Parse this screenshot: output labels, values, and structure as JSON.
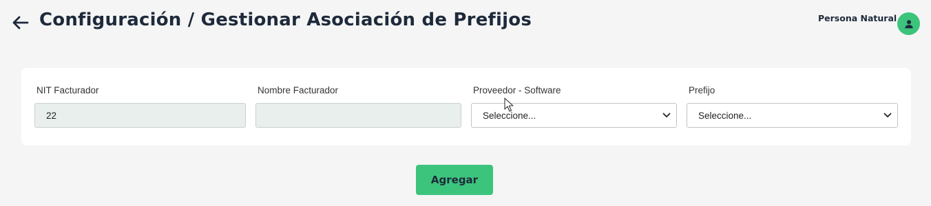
{
  "header": {
    "title": "Configuración / Gestionar Asociación de Prefijos",
    "back_icon": "arrow-left-icon",
    "user_name": "Persona Natural",
    "avatar_icon": "user-icon",
    "accent_color": "#3cc47c"
  },
  "form": {
    "nit": {
      "label": "NIT Facturador",
      "value": "22"
    },
    "nombre": {
      "label": "Nombre Facturador",
      "value": ""
    },
    "proveedor": {
      "label": "Proveedor - Software",
      "selected": "Seleccione..."
    },
    "prefijo": {
      "label": "Prefijo",
      "selected": "Seleccione..."
    }
  },
  "actions": {
    "add_label": "Agregar"
  }
}
